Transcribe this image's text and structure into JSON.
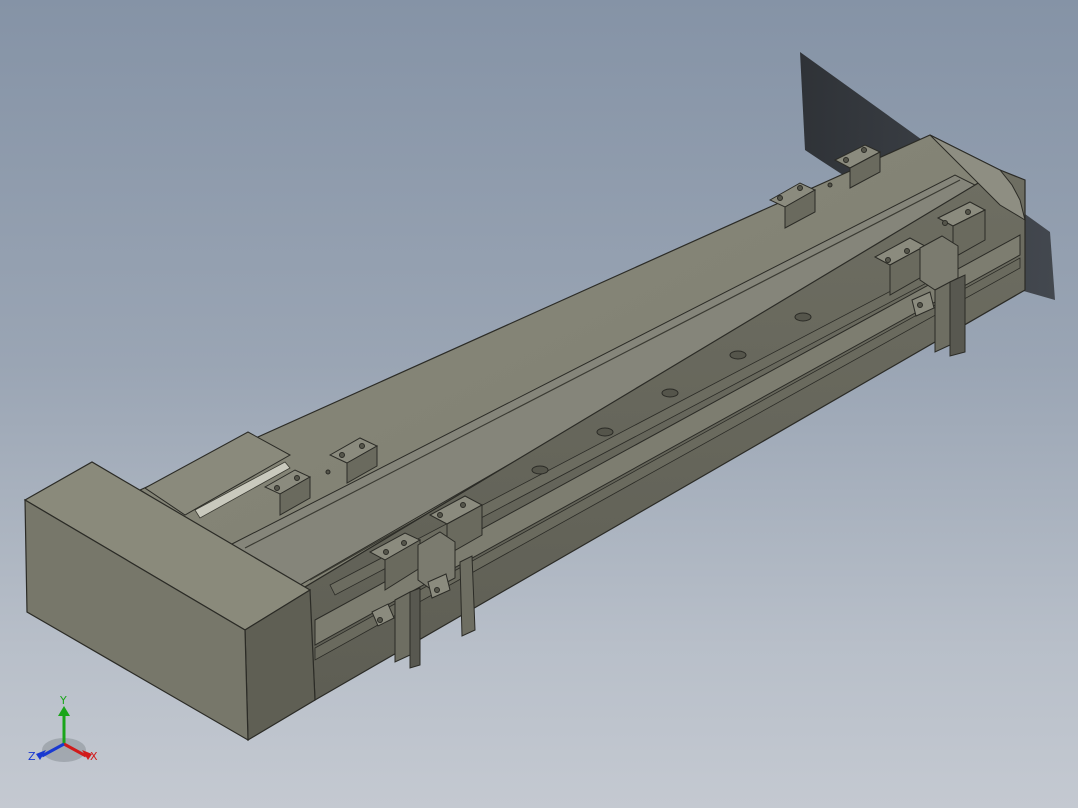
{
  "viewport": {
    "background_top": "#8593a6",
    "background_bottom": "#c4c9d1"
  },
  "model": {
    "description_icon": "linear-module-3d-model",
    "body_color": "#7a7a6a",
    "shadow_color": "#2c2f33"
  },
  "triad": {
    "x_label": "X",
    "y_label": "Y",
    "z_label": "Z",
    "x_color": "#d11a1a",
    "y_color": "#1aa51a",
    "z_color": "#1a3ad1"
  }
}
